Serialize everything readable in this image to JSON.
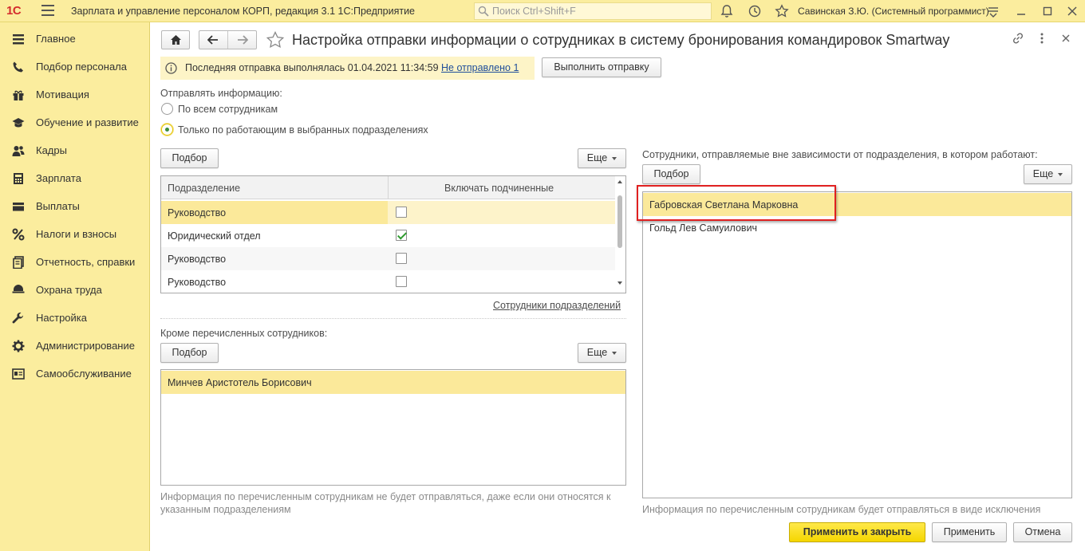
{
  "app": {
    "logo": "1С",
    "title": "Зарплата и управление персоналом КОРП, редакция 3.1 1С:Предприятие",
    "search_placeholder": "Поиск Ctrl+Shift+F",
    "user": "Савинская З.Ю. (Системный программист)"
  },
  "sidebar": {
    "items": [
      {
        "label": "Главное",
        "icon": "menu-lines-icon"
      },
      {
        "label": "Подбор персонала",
        "icon": "phone-icon"
      },
      {
        "label": "Мотивация",
        "icon": "gift-icon"
      },
      {
        "label": "Обучение и развитие",
        "icon": "graduation-cap-icon"
      },
      {
        "label": "Кадры",
        "icon": "people-icon"
      },
      {
        "label": "Зарплата",
        "icon": "calculator-icon"
      },
      {
        "label": "Выплаты",
        "icon": "wallet-icon"
      },
      {
        "label": "Налоги и взносы",
        "icon": "percent-icon"
      },
      {
        "label": "Отчетность, справки",
        "icon": "report-icon"
      },
      {
        "label": "Охрана труда",
        "icon": "shield-icon"
      },
      {
        "label": "Настройка",
        "icon": "wrench-icon"
      },
      {
        "label": "Администрирование",
        "icon": "gear-icon"
      },
      {
        "label": "Самообслуживание",
        "icon": "id-card-icon"
      }
    ]
  },
  "form": {
    "title": "Настройка отправки информации о сотрудниках в систему бронирования командировок Smartway",
    "info": {
      "text": "Последняя отправка выполнялась 01.04.2021 11:34:59",
      "link": "Не отправлено 1",
      "send_button": "Выполнить отправку"
    },
    "send_mode": {
      "label": "Отправлять информацию:",
      "options": [
        "По всем сотрудникам",
        "Только по работающим в выбранных подразделениях"
      ],
      "selected": 1
    },
    "departments": {
      "pick_button": "Подбор",
      "more_button": "Еще",
      "columns": [
        "Подразделение",
        "Включать подчиненные"
      ],
      "rows": [
        {
          "name": "Руководство",
          "include": false
        },
        {
          "name": "Юридический отдел",
          "include": true
        },
        {
          "name": "Руководство",
          "include": false
        },
        {
          "name": "Руководство",
          "include": false
        }
      ],
      "link": "Сотрудники подразделений"
    },
    "excluded": {
      "label": "Кроме перечисленных сотрудников:",
      "pick_button": "Подбор",
      "more_button": "Еще",
      "rows": [
        "Минчев Аристотель Борисович"
      ],
      "hint": "Информация по перечисленным сотрудникам не будет отправляться, даже если они относятся к указанным подразделениям"
    },
    "included": {
      "label": "Сотрудники, отправляемые вне зависимости от подразделения, в котором работают:",
      "pick_button": "Подбор",
      "more_button": "Еще",
      "rows": [
        "Габровская Светлана Марковна",
        "Гольд Лев Самуилович"
      ],
      "hint": "Информация по перечисленным сотрудникам будет отправляться в виде исключения"
    },
    "footer": {
      "apply_close": "Применить и закрыть",
      "apply": "Применить",
      "cancel": "Отмена"
    }
  },
  "colors": {
    "accent_yellow": "#fbed9e",
    "selection": "#fbe99a",
    "highlight_frame": "#e02020",
    "link": "#1f4e9a"
  }
}
